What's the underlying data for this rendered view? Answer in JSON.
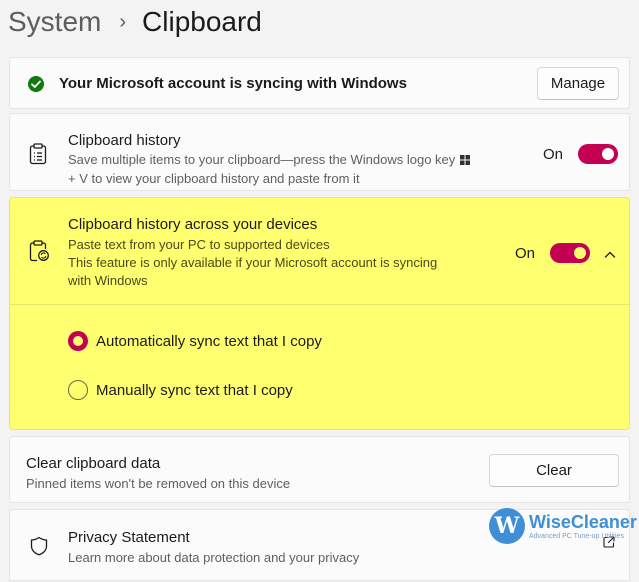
{
  "breadcrumb": {
    "parent": "System",
    "separator": "›",
    "title": "Clipboard"
  },
  "sync_banner": {
    "text": "Your Microsoft account is syncing with Windows",
    "button": "Manage",
    "status_color": "#0f7b0f"
  },
  "clipboard_history": {
    "title": "Clipboard history",
    "desc_line1": "Save multiple items to your clipboard—press the Windows logo key",
    "desc_line2": "+ V to view your clipboard history and paste from it",
    "toggle_label": "On",
    "toggle_on": true
  },
  "across_devices": {
    "title": "Clipboard history across your devices",
    "desc_line1": "Paste text from your PC to supported devices",
    "desc_line2": "This feature is only available if your Microsoft account is syncing",
    "desc_line3": "with Windows",
    "toggle_label": "On",
    "toggle_on": true,
    "expanded": true,
    "options": [
      {
        "label": "Automatically sync text that I copy",
        "selected": true
      },
      {
        "label": "Manually sync text that I copy",
        "selected": false
      }
    ]
  },
  "clear_data": {
    "title": "Clear clipboard data",
    "desc": "Pinned items won't be removed on this device",
    "button": "Clear"
  },
  "privacy": {
    "title": "Privacy Statement",
    "desc": "Learn more about data protection and your privacy"
  },
  "watermark": {
    "name": "WiseCleaner",
    "tagline": "Advanced PC Tune-up Utilities",
    "logo_letter": "W"
  },
  "colors": {
    "accent": "#c30052",
    "highlight": "#ffff70",
    "page_bg": "#f3f3f3"
  }
}
